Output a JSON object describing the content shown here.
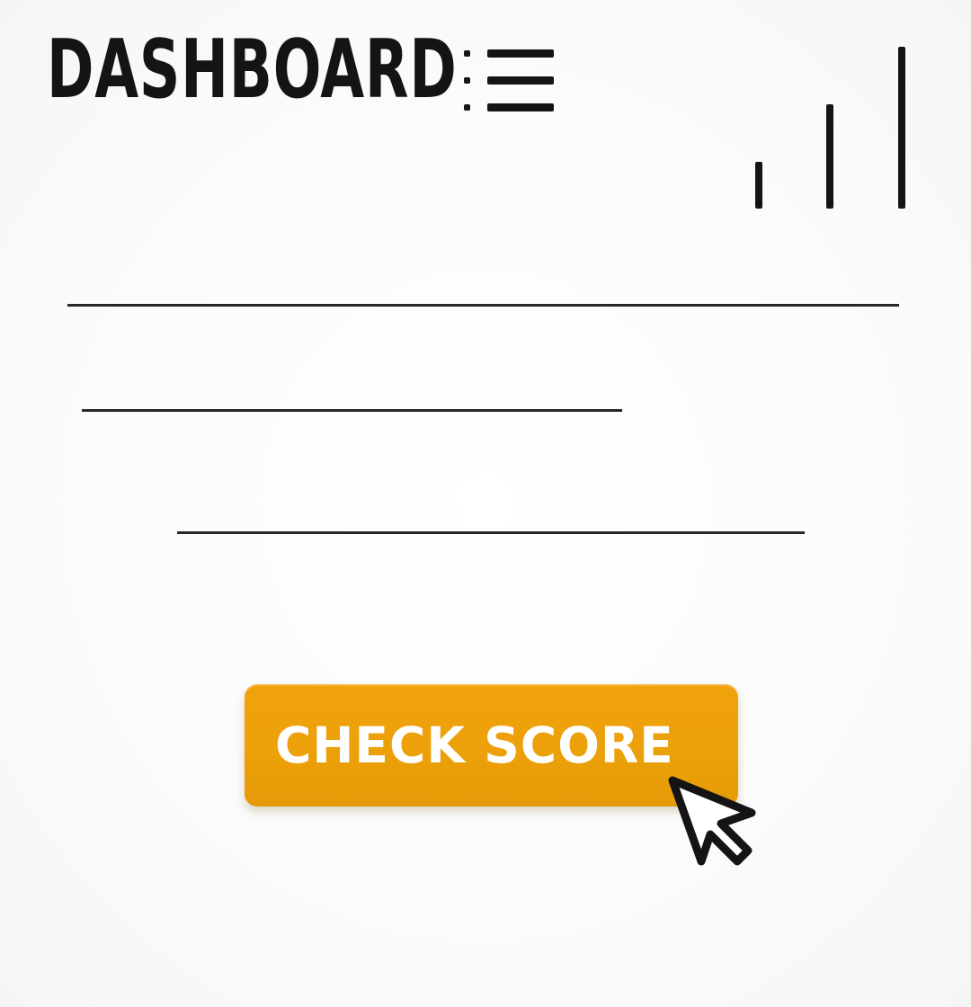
{
  "header": {
    "title": "DASHBOARD"
  },
  "icons": {
    "menu": "menu-list-icon",
    "signal": "signal-bars-icon",
    "cursor": "mouse-pointer-icon"
  },
  "actions": {
    "primary_label": "CHECK SCORE"
  },
  "colors": {
    "accent": "#eba009",
    "text": "#141414",
    "background": "#fbfbfb"
  }
}
